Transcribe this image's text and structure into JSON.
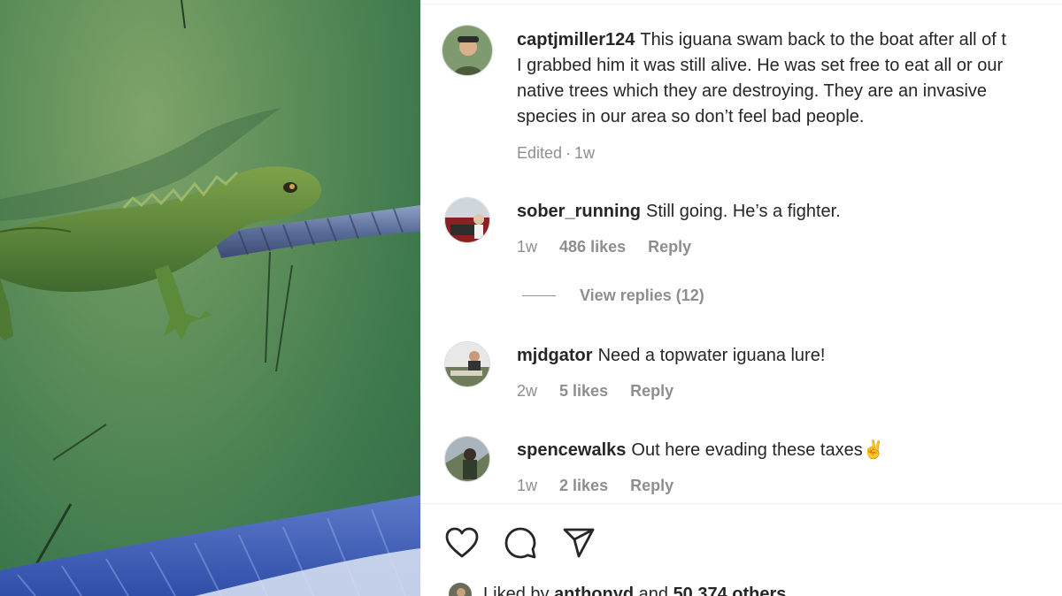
{
  "media": {
    "alt_icon": "iguana-on-rope-photo"
  },
  "post": {
    "caption": {
      "username": "captjmiller124",
      "lines": [
        "This iguana swam back to the boat after all of t",
        "I grabbed him it was still alive. He was set free to eat all or our",
        "native trees which they are destroying. They are an invasive",
        "species in our area so don’t feel bad people."
      ],
      "edited": "Edited",
      "time": "1w"
    }
  },
  "comments": [
    {
      "username": "sober_running",
      "text": "Still going. He’s a fighter.",
      "time": "1w",
      "likes": "486 likes",
      "reply": "Reply",
      "view_replies": "View replies (12)"
    },
    {
      "username": "mjdgator",
      "text": "Need a topwater iguana lure!",
      "time": "2w",
      "likes": "5 likes",
      "reply": "Reply"
    },
    {
      "username": "spencewalks",
      "text": "Out here evading these taxes",
      "emoji": "✌️",
      "time": "1w",
      "likes": "2 likes",
      "reply": "Reply"
    }
  ],
  "actions": {
    "like_icon": "heart-icon",
    "comment_icon": "comment-bubble-icon",
    "share_icon": "paper-plane-icon"
  },
  "liked_by": {
    "prefix": "Liked by",
    "user": "anthonyd",
    "middle": "and",
    "count": "50,374 others"
  },
  "colors": {
    "text": "#262626",
    "secondary": "#8e8e8e",
    "divider": "#efefef",
    "water": "#4f8655"
  }
}
